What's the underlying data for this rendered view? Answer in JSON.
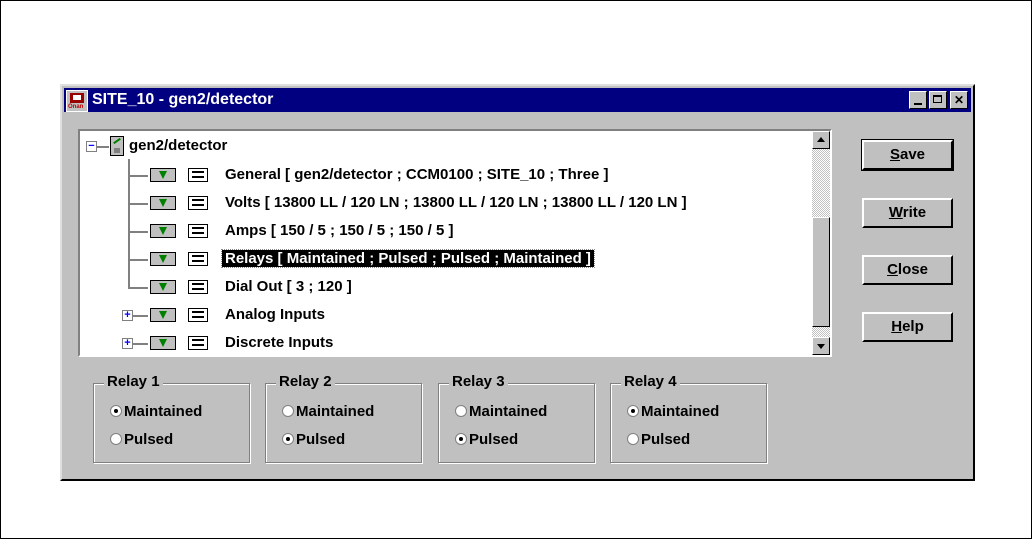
{
  "window": {
    "title": "SITE_10 - gen2/detector",
    "icon_caption": "Onan"
  },
  "tree": {
    "root": {
      "label": "gen2/detector",
      "expander": "−"
    },
    "items": [
      {
        "label": "General  [ gen2/detector ; CCM0100 ; SITE_10 ; Three ]"
      },
      {
        "label": "Volts  [ 13800 LL / 120 LN ; 13800 LL / 120 LN ; 13800 LL / 120 LN ]"
      },
      {
        "label": "Amps  [ 150 / 5 ; 150 / 5 ; 150 / 5 ]"
      },
      {
        "label": "Relays  [ Maintained ; Pulsed ; Pulsed ; Maintained ]",
        "selected": true
      },
      {
        "label": "Dial Out  [ 3 ; 120 ]"
      },
      {
        "label": "Analog Inputs",
        "expander": "+"
      },
      {
        "label": "Discrete Inputs",
        "expander": "+"
      }
    ]
  },
  "buttons": {
    "save": {
      "mnemonic": "S",
      "rest": "ave"
    },
    "write": {
      "mnemonic": "W",
      "rest": "rite"
    },
    "close": {
      "mnemonic": "C",
      "rest": "lose"
    },
    "help": {
      "mnemonic": "H",
      "rest": "elp"
    }
  },
  "relays": [
    {
      "title": "Relay 1",
      "option1": "Maintained",
      "option2": "Pulsed",
      "selected": "Maintained"
    },
    {
      "title": "Relay 2",
      "option1": "Maintained",
      "option2": "Pulsed",
      "selected": "Pulsed"
    },
    {
      "title": "Relay 3",
      "option1": "Maintained",
      "option2": "Pulsed",
      "selected": "Pulsed"
    },
    {
      "title": "Relay 4",
      "option1": "Maintained",
      "option2": "Pulsed",
      "selected": "Maintained"
    }
  ]
}
